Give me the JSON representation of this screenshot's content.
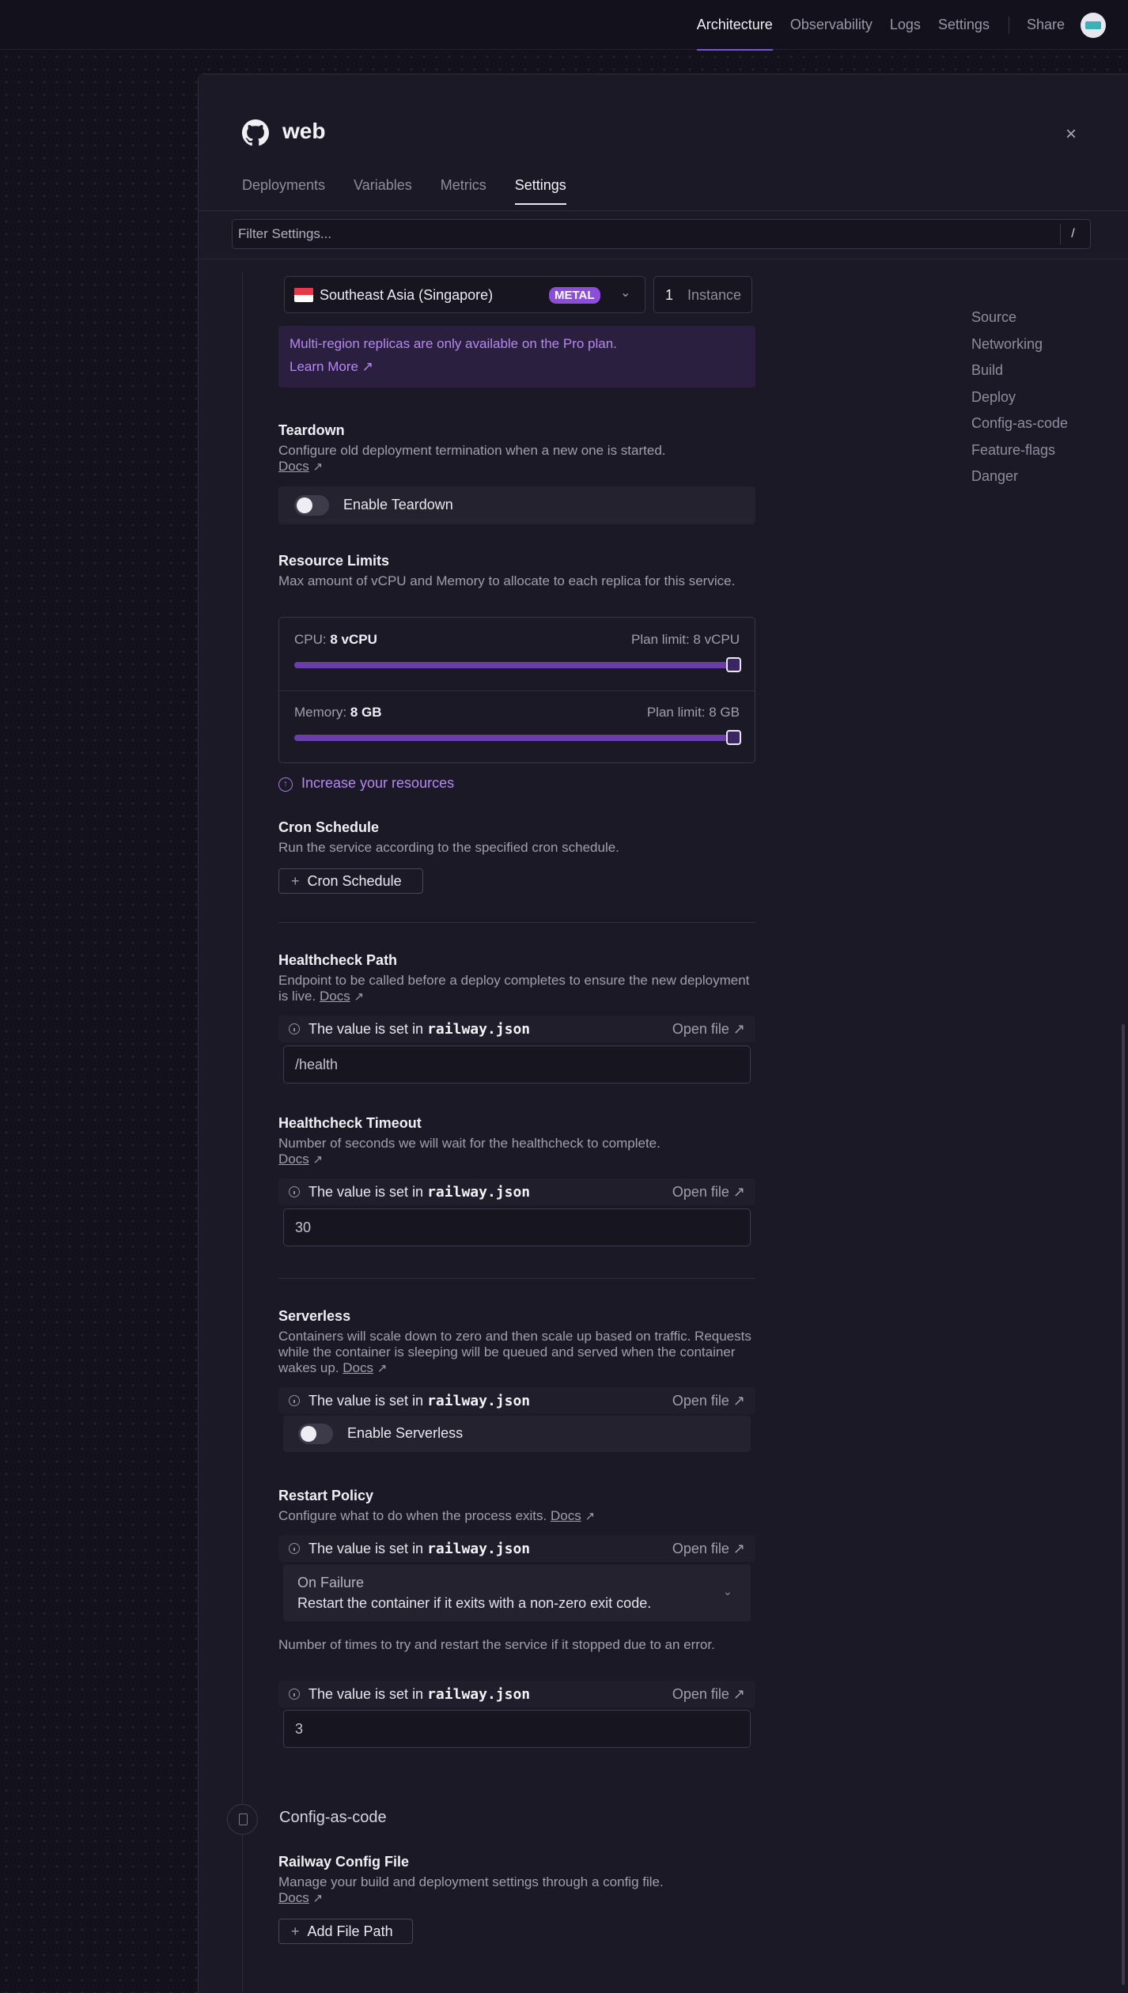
{
  "topnav": {
    "items": [
      "Architecture",
      "Observability",
      "Logs",
      "Settings"
    ],
    "share": "Share"
  },
  "panel": {
    "title": "web",
    "close": "×",
    "tabs": [
      "Deployments",
      "Variables",
      "Metrics",
      "Settings"
    ],
    "filter_placeholder": "Filter Settings...",
    "filter_shortcut": "/"
  },
  "sidenav": [
    "Source",
    "Networking",
    "Build",
    "Deploy",
    "Config-as-code",
    "Feature-flags",
    "Danger"
  ],
  "regions": {
    "region": "Southeast Asia (Singapore)",
    "badge": "METAL",
    "instances": "1",
    "instance_label": "Instance",
    "promo_text": "Multi-region replicas are only available on the Pro plan.",
    "promo_link": "Learn More ↗"
  },
  "teardown": {
    "title": "Teardown",
    "desc": "Configure old deployment termination when a new one is started.",
    "docs": "Docs",
    "toggle_label": "Enable Teardown",
    "enabled": false
  },
  "limits": {
    "title": "Resource Limits",
    "desc": "Max amount of vCPU and Memory to allocate to each replica for this service.",
    "cpu_label": "CPU:",
    "cpu_value": "8 vCPU",
    "cpu_plan": "Plan limit: 8 vCPU",
    "cpu_fraction": 1.0,
    "mem_label": "Memory:",
    "mem_value": "8 GB",
    "mem_plan": "Plan limit: 8 GB",
    "mem_fraction": 1.0,
    "increase_link": "Increase your resources"
  },
  "cron": {
    "title": "Cron Schedule",
    "desc": "Run the service according to the specified cron schedule.",
    "button": "Cron Schedule"
  },
  "notice": {
    "prefix": "The value is set in",
    "file": "railway.json",
    "open": "Open file ↗"
  },
  "health_path": {
    "title": "Healthcheck Path",
    "desc": "Endpoint to be called before a deploy completes to ensure the new deployment is live.",
    "docs": "Docs",
    "value": "/health"
  },
  "health_timeout": {
    "title": "Healthcheck Timeout",
    "desc": "Number of seconds we will wait for the healthcheck to complete.",
    "docs": "Docs",
    "value": "30"
  },
  "serverless": {
    "title": "Serverless",
    "desc": "Containers will scale down to zero and then scale up based on traffic. Requests while the container is sleeping will be queued and served when the container wakes up.",
    "docs": "Docs",
    "toggle_label": "Enable Serverless",
    "enabled": false
  },
  "restart": {
    "title": "Restart Policy",
    "desc": "Configure what to do when the process exits.",
    "docs": "Docs",
    "policy": "On Failure",
    "policy_desc": "Restart the container if it exits with a non-zero exit code.",
    "retries_desc": "Number of times to try and restart the service if it stopped due to an error.",
    "retries_value": "3"
  },
  "config_section": {
    "title": "Config-as-code",
    "file_title": "Railway Config File",
    "file_desc": "Manage your build and deployment settings through a config file.",
    "docs": "Docs",
    "button": "Add File Path"
  },
  "colors": {
    "accent": "#7c52d8",
    "promo_text": "#b589f0",
    "badge": "#8c4ed9",
    "background": "#13111c",
    "panel": "#1b1926"
  }
}
